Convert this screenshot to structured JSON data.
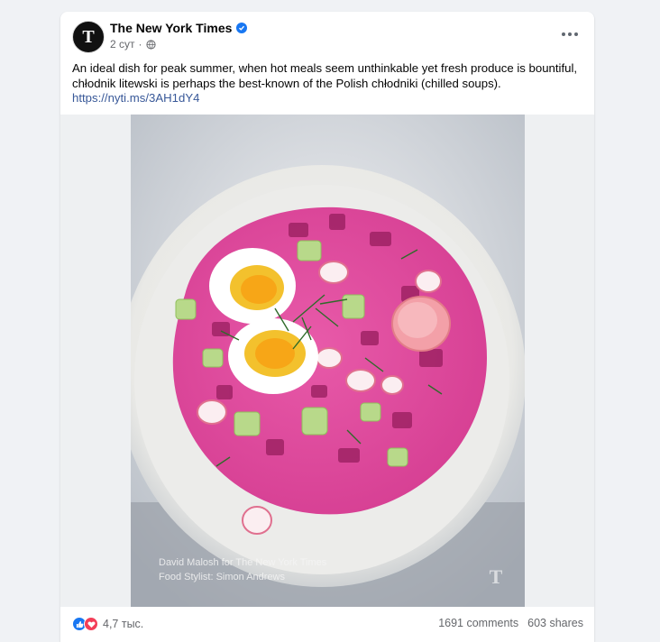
{
  "post": {
    "author": "The New York Times",
    "time": "2 сут",
    "audience_icon": "globe-icon",
    "text": "An ideal dish for peak summer, when hot meals seem unthinkable yet fresh produce is bountiful, chłodnik litewski is perhaps the best-known of the Polish chłodniki (chilled soups).",
    "link": "https://nyti.ms/3AH1dY4",
    "photo": {
      "credit_line1": "David Malosh for The New York Times",
      "credit_line2": "Food Stylist: Simon Andrews"
    }
  },
  "footer": {
    "reaction_icons": [
      "like-icon",
      "love-icon"
    ],
    "reaction_count": "4,7 тыс.",
    "comments": "1691 comments",
    "shares": "603 shares"
  },
  "colors": {
    "link": "#385898",
    "verified": "#1877f2",
    "soup": "#e0479e"
  }
}
